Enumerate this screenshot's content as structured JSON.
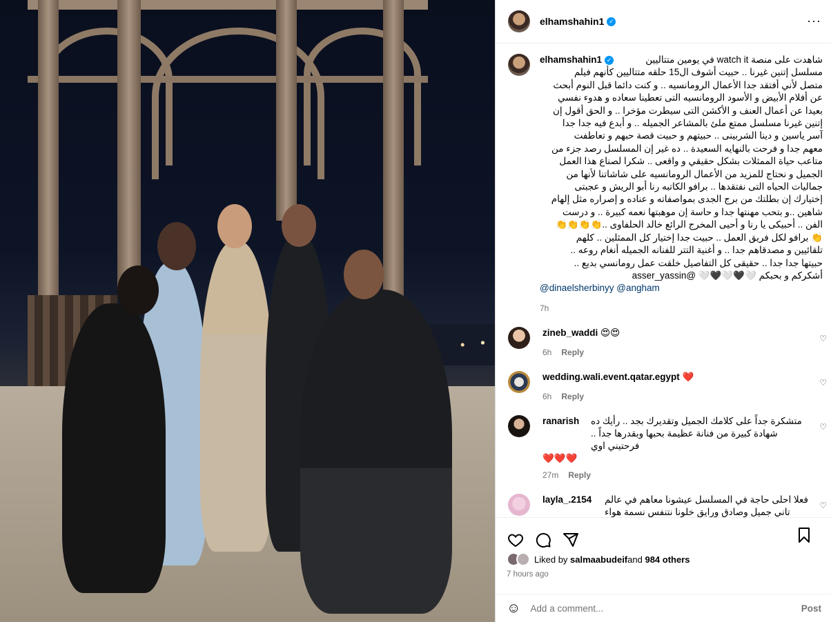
{
  "post": {
    "username": "elhamshahin1",
    "caption_lines": [
      "شاهدت على منصة watch it في يومين متتاليين",
      "مسلسل إتنين غيرنا .. حبيت أشوف ال15 حلقه متتاليين كأنهم فيلم",
      "متصل لأني أفتقد جدا الأعمال الرومانسيه .. و كنت دائما قبل النوم أبحث",
      "عن أفلام الأبيض و الأسود الرومانسيه التى تعطينا سعاده و هدوء نفسي",
      "بعيدا عن أعمال العنف و الأكشن التى سيطرت مؤخرا .. و الحق أقول إن",
      "إتنين غيرنا مسلسل ممتع ملئ بالمشاعر الجميله .. و أبدع فيه جدا جدا",
      "آسر ياسين و دينا الشربينى .. حبيتهم و حبيت قصة حبهم و تعاطفت",
      "معهم جدا و فرحت بالنهايه السعيدة .. ده غير إن المسلسل رصد جزء من",
      "متاعب حياة الممثلات بشكل حقيقي و واقعى .. شكرا لصناع هذا العمل",
      "الجميل و نحتاج للمزيد من الأعمال الرومانسيه على شاشاتنا لأنها من",
      "جماليات الحياه التى نفتقدها .. برافو الكاتبه رنا أبو الريش و عجبتى",
      "إختيارك إن بطلتك من برج الجدى بمواصفاته و عناده و إصراره مثل إلهام",
      "شاهين ..و بتحب مهنتها جدا و حاسة إن موهبتها نعمه كبيرة .. و درست",
      "الفن .. أحبيكى يا رنا و أحيى المخرج الرائع خالد الحلفاوى ..👏👏👏👏",
      "👏 برافو لكل فريق العمل .. حبيت جدا إختيار كل الممثلين .. كلهم",
      "تلقائيين و مصدقاهم جدا .. و أغنية التتر للفنانه الجميله أنغام روعه ..",
      "حبيتها جدا جدا .. حقيقى كل التفاصيل خلقت عمل رومانسي بديع ..",
      "أشكركم و بحبكم 🤍🖤🤍🖤🤍 @asser_yassin"
    ],
    "mentions_line": "@dinaelsherbinyy @angham",
    "caption_time": "7h",
    "likes_avatars": 2,
    "liked_by_prefix": "Liked by ",
    "liked_by_user": "salmaabudeif",
    "liked_by_suffix": " and ",
    "likes_count": "984 others",
    "posted_time": "7 hours ago",
    "add_comment_placeholder": "Add a comment...",
    "post_button": "Post",
    "colors": {
      "link": "#00376b",
      "verified": "#0095f6",
      "meta": "#737373"
    }
  },
  "comments": [
    {
      "username": "zineb_waddi",
      "text": "😍😍",
      "time": "6h",
      "reply": "Reply",
      "extra": ""
    },
    {
      "username": "wedding.wali.event.qatar.egypt",
      "text": "❤️",
      "time": "6h",
      "reply": "Reply",
      "extra": ""
    },
    {
      "username": "ranarish",
      "text": "متشكرة جداً على كلامك الجميل وتقديرك بجد .. رأيك ده شهادة كبيرة من فنانة عظيمة بحبها وبقدرها جداً .. فرحتيني اوي",
      "extra": "❤️❤️❤️",
      "time": "27m",
      "reply": "Reply"
    },
    {
      "username": "layla_.2154",
      "text": "فعلا احلى حاجة في المسلسل عيشونا معاهم في عالم تاني جميل وصادق ورايق خلونا نتنفس نسمة هواء عليل على قلوبنا",
      "extra": "❤️🔥👏👏",
      "time": "",
      "reply": ""
    }
  ]
}
